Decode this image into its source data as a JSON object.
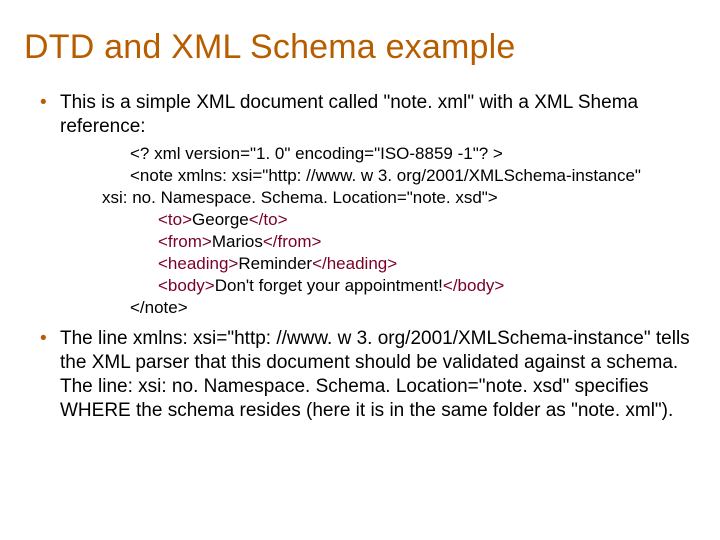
{
  "title": "DTD and XML Schema example",
  "bullets": {
    "b1": "This is a simple XML document called \"note. xml\" with a XML Shema reference:",
    "b2": "The line xmlns: xsi=\"http: //www. w 3. org/2001/XMLSchema-instance\" tells the XML parser that this document should be validated against a schema. The line: xsi: no. Namespace. Schema. Location=\"note. xsd\" specifies WHERE the schema resides (here it is in the same folder as \"note. xml\")."
  },
  "code": {
    "l1": "<? xml version=\"1. 0\" encoding=\"ISO-8859 -1\"? >",
    "l2a": "<note xmlns: xsi=\"http: //www. w 3. org/2001/XMLSchema-instance\"",
    "l2b": "xsi: no. Namespace. Schema. Location=\"note. xsd\">",
    "l3_open": "<to>",
    "l3_text": "George",
    "l3_close": "</to>",
    "l4_open": "<from>",
    "l4_text": "Marios",
    "l4_close": "</from>",
    "l5_open": "<heading>",
    "l5_text": "Reminder",
    "l5_close": "</heading>",
    "l6_open": "<body>",
    "l6_text": "Don't forget your appointment!",
    "l6_close": "</body>",
    "l7": "</note>"
  }
}
